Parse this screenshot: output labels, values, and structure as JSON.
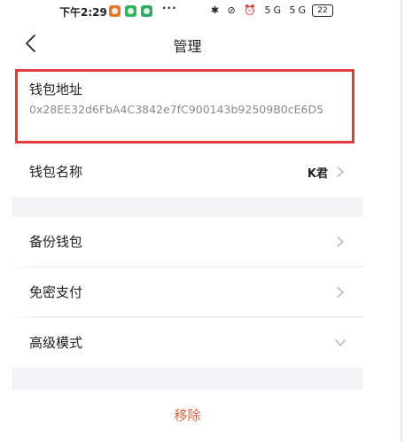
{
  "status_bar": {
    "time": "下午2:29",
    "more": "···",
    "signal_text": "✱ ⊘ ⏰ 5G 5G",
    "battery": "22"
  },
  "nav": {
    "title": "管理",
    "back_icon": "chevron-left-icon"
  },
  "wallet_address": {
    "label": "钱包地址",
    "value": "0x28EE32d6FbA4C3842e7fC900143b92509B0cE6D5"
  },
  "wallet_name": {
    "label": "钱包名称",
    "value": "K君"
  },
  "menu": {
    "backup": "备份钱包",
    "password_free": "免密支付",
    "advanced_mode": "高级模式"
  },
  "remove": {
    "label": "移除"
  },
  "colors": {
    "highlight_frame": "#e43b3b",
    "remove_text": "#e0623e",
    "background": "#f4f4f6"
  }
}
